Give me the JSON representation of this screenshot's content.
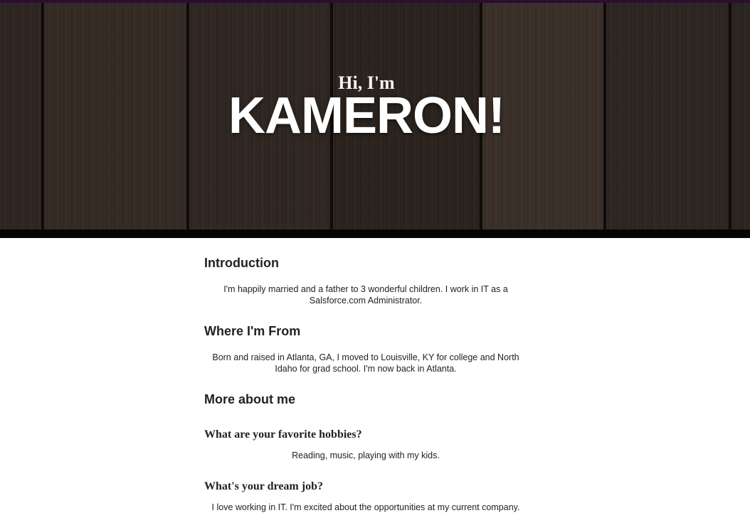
{
  "hero": {
    "greeting": "Hi, I'm",
    "name": "KAMERON!"
  },
  "sections": {
    "introduction": {
      "heading": "Introduction",
      "text": "I'm happily married and a father to 3 wonderful children. I work in IT as a Salsforce.com Administrator."
    },
    "where_from": {
      "heading": "Where I'm From",
      "text": "Born and raised in Atlanta, GA, I moved to Louisville, KY for college and North Idaho for grad school. I'm now back in Atlanta."
    },
    "more_about": {
      "heading": "More about me",
      "questions": [
        {
          "question": "What are your favorite hobbies?",
          "answer": "Reading, music, playing with my kids."
        },
        {
          "question": "What's your dream job?",
          "answer": "I love working in IT. I'm excited about the opportunities at my current company."
        }
      ]
    }
  },
  "colors": {
    "top_strip": "#2a0f2e",
    "hero_wood": "#2b231f",
    "text": "#222222"
  }
}
